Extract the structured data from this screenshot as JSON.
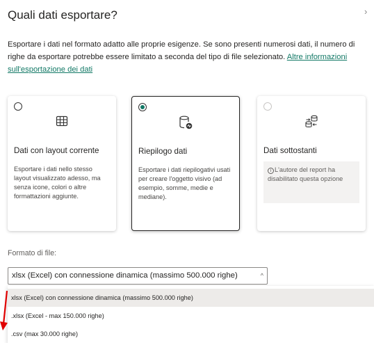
{
  "dialog": {
    "title": "Quali dati esportare?",
    "close_glyph": "›",
    "description": "Esportare i dati nel formato adatto alle proprie esigenze. Se sono presenti numerosi dati, il numero di righe da esportare potrebbe essere limitato a seconda del tipo di file selezionato.",
    "learn_more_link": "Altre informazioni sull'esportazione dei dati"
  },
  "cards": [
    {
      "title": "Dati con layout corrente",
      "description": "Esportare i dati nello stesso layout visualizzato adesso, ma senza icone, colori o altre formattazioni aggiunte.",
      "icon": "table-grid-icon",
      "selected": false,
      "disabled": false
    },
    {
      "title": "Riepilogo dati",
      "description": "Esportare i dati riepilogativi usati per creare l'oggetto visivo (ad esempio, somme, medie e mediane).",
      "icon": "database-summary-icon",
      "selected": true,
      "disabled": false
    },
    {
      "title": "Dati sottostanti",
      "info_text": "L'autore del report ha disabilitato questa opzione",
      "icon": "database-transfer-icon",
      "selected": false,
      "disabled": true
    }
  ],
  "file_format": {
    "label": "Formato di file:",
    "selected_value": "xlsx (Excel) con connessione dinamica (massimo 500.000 righe)",
    "chevron_glyph": "^",
    "options": [
      "xlsx (Excel) con connessione dinamica (massimo 500.000 righe)",
      ".xlsx (Excel - max 150.000 righe)",
      ".csv (max 30.000 righe)"
    ]
  },
  "colors": {
    "accent": "#117865",
    "annotation_arrow": "#e00000"
  }
}
